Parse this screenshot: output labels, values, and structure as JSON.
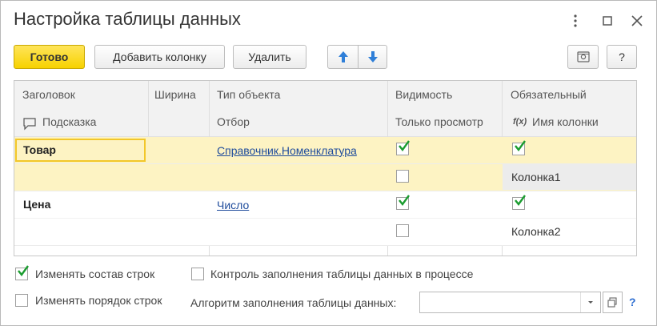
{
  "window": {
    "title": "Настройка таблицы данных",
    "menu_icon": "more-vertical-icon",
    "maximize_icon": "maximize-icon",
    "close_icon": "close-icon"
  },
  "toolbar": {
    "done_label": "Готово",
    "add_column_label": "Добавить колонку",
    "delete_label": "Удалить",
    "move_up_icon": "arrow-up-icon",
    "move_down_icon": "arrow-down-icon",
    "settings_icon": "settings-icon",
    "help_label": "?"
  },
  "grid": {
    "header_row1": {
      "title": "Заголовок",
      "width": "Ширина",
      "object_type": "Тип объекта",
      "visibility": "Видимость",
      "required": "Обязательный"
    },
    "header_row2": {
      "hint": "Подсказка",
      "filter": "Отбор",
      "read_only": "Только просмотр",
      "fx": "f(x)",
      "column_name": "Имя колонки"
    },
    "rows": [
      {
        "title": "Товар",
        "type": "Справочник.Номенклатура",
        "visible": true,
        "required": true,
        "read_only": false,
        "column_name": "Колонка1"
      },
      {
        "title": "Цена",
        "type": "Число",
        "visible": true,
        "required": true,
        "read_only": false,
        "column_name": "Колонка2"
      }
    ]
  },
  "options": {
    "change_rows": {
      "label": "Изменять состав строк",
      "checked": true
    },
    "change_order": {
      "label": "Изменять порядок строк",
      "checked": false
    },
    "fill_control": {
      "label": "Контроль заполнения таблицы данных в процессе",
      "checked": false
    },
    "algorithm_label": "Алгоритм заполнения таблицы данных:",
    "algorithm_value": "",
    "help_label": "?"
  },
  "colors": {
    "accent_yellow": "#f7d200",
    "selected_row": "#fdf3c3",
    "link": "#1f4c9c",
    "check_green": "#1a9c2f",
    "help_blue": "#2f6fd1"
  }
}
